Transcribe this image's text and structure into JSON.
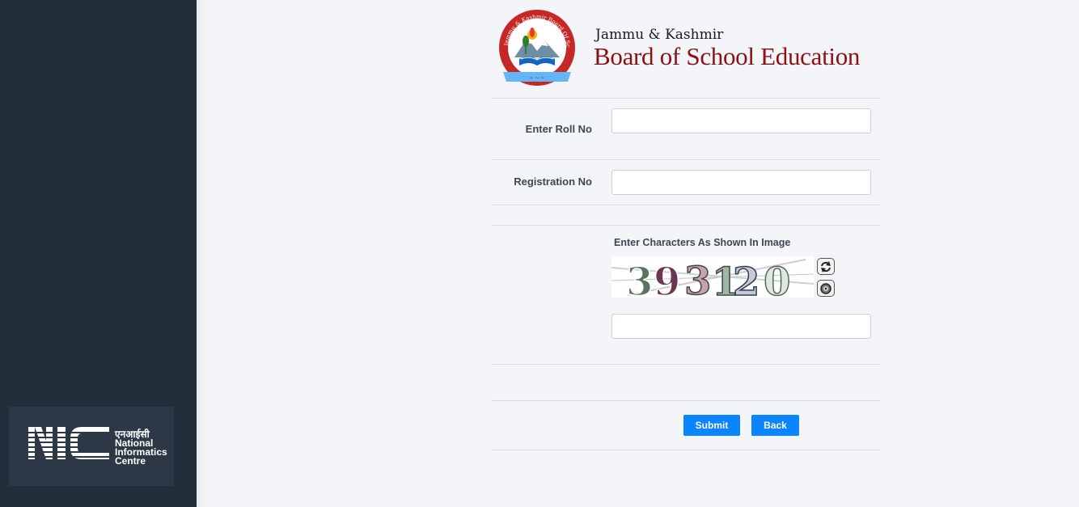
{
  "sidebar": {
    "nic": {
      "logo_text": "NIC",
      "hindi": "एनआईसी",
      "line1": "National",
      "line2": "Informatics",
      "line3": "Centre"
    }
  },
  "header": {
    "logo_text": "Jammu & Kashmir Board Of School Education",
    "brand_top": "Jammu & Kashmir",
    "brand_main": "Board of School Education"
  },
  "form": {
    "roll_label": "Enter Roll No",
    "roll_value": "",
    "reg_label": "Registration No",
    "reg_value": "",
    "captcha_label": "Enter Characters As Shown In Image",
    "captcha_text": "393120",
    "captcha_value": "",
    "refresh_icon": "refresh-icon",
    "audio_icon": "speaker-icon"
  },
  "actions": {
    "submit_label": "Submit",
    "back_label": "Back"
  },
  "colors": {
    "sidebar": "#222d3a",
    "brand": "#8b1014",
    "button": "#0a84ff",
    "page": "#f4f5f9"
  }
}
